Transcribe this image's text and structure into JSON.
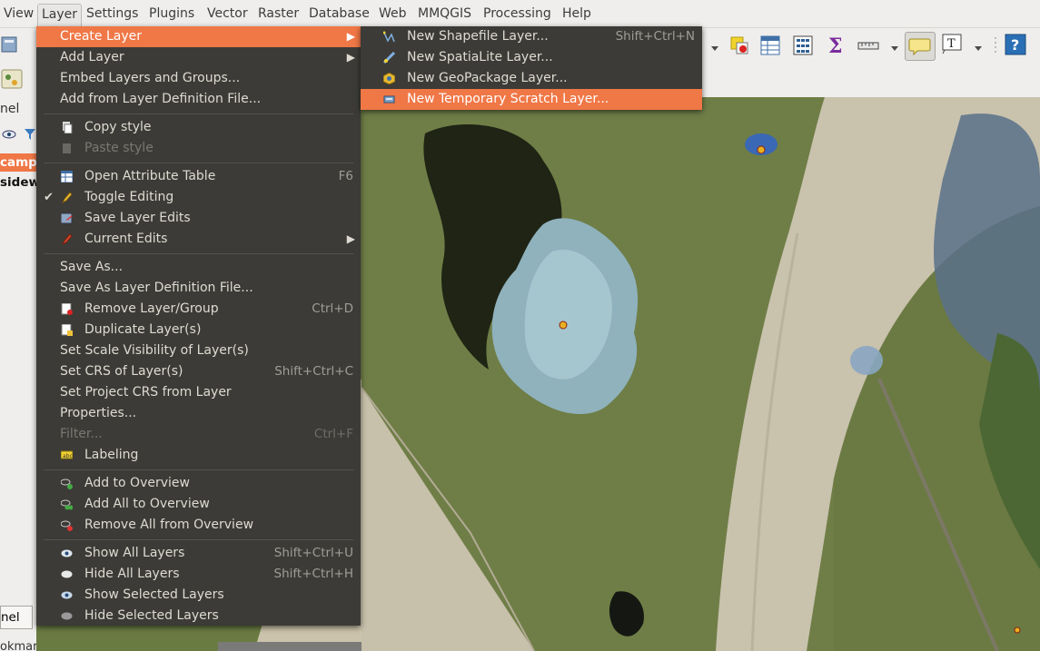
{
  "menubar": [
    "View",
    "Layer",
    "Settings",
    "Plugins",
    "Vector",
    "Raster",
    "Database",
    "Web",
    "MMQGIS",
    "Processing",
    "Help"
  ],
  "left_panel": {
    "panel_label": "nel",
    "layer1": "camp",
    "layer2": "sidew",
    "bottom_tab": "nel",
    "bottom_panel": "okmarks Panel"
  },
  "layer_menu": {
    "create_layer": "Create Layer",
    "add_layer": "Add Layer",
    "embed": "Embed Layers and Groups...",
    "add_from_def": "Add from Layer Definition File...",
    "copy_style": "Copy style",
    "paste_style": "Paste style",
    "open_attr": "Open Attribute Table",
    "open_attr_sc": "F6",
    "toggle_editing": "Toggle Editing",
    "save_edits": "Save Layer Edits",
    "current_edits": "Current Edits",
    "save_as": "Save As...",
    "save_as_def": "Save As Layer Definition File...",
    "remove_layer": "Remove Layer/Group",
    "remove_layer_sc": "Ctrl+D",
    "duplicate": "Duplicate Layer(s)",
    "scale_vis": "Set Scale Visibility of Layer(s)",
    "set_crs": "Set CRS of Layer(s)",
    "set_crs_sc": "Shift+Ctrl+C",
    "set_project_crs": "Set Project CRS from Layer",
    "properties": "Properties...",
    "filter": "Filter...",
    "filter_sc": "Ctrl+F",
    "labeling": "Labeling",
    "add_overview": "Add to Overview",
    "add_all_overview": "Add All to Overview",
    "remove_all_overview": "Remove All from Overview",
    "show_all": "Show All Layers",
    "show_all_sc": "Shift+Ctrl+U",
    "hide_all": "Hide All Layers",
    "hide_all_sc": "Shift+Ctrl+H",
    "show_selected": "Show Selected Layers",
    "hide_selected": "Hide Selected Layers"
  },
  "create_submenu": {
    "shapefile": "New Shapefile Layer...",
    "shapefile_sc": "Shift+Ctrl+N",
    "spatialite": "New SpatiaLite Layer...",
    "geopackage": "New GeoPackage Layer...",
    "scratch": "New Temporary Scratch Layer..."
  },
  "colors": {
    "menu_bg": "#3c3b37",
    "highlight": "#f07746",
    "menubar_bg": "#efeeec"
  }
}
